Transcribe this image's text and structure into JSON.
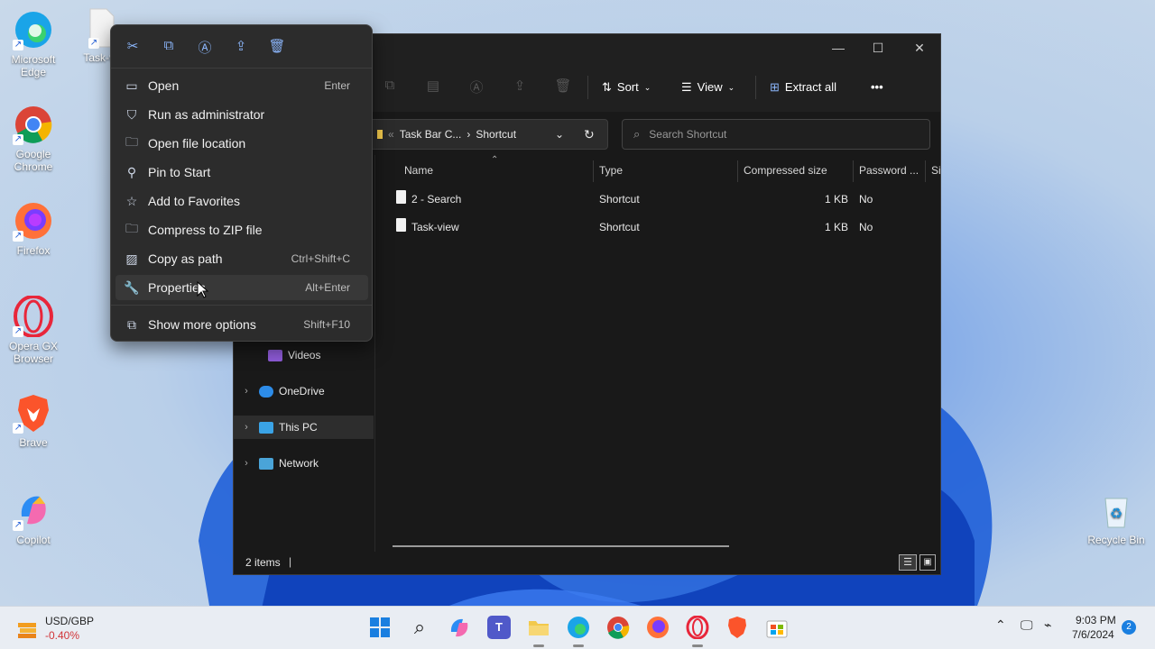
{
  "desktop": {
    "icons": [
      {
        "label": "Microsoft Edge"
      },
      {
        "label": "Google Chrome"
      },
      {
        "label": "Firefox"
      },
      {
        "label": "Opera GX Browser"
      },
      {
        "label": "Brave"
      },
      {
        "label": "Copilot"
      },
      {
        "label": "Task-vi"
      },
      {
        "label": "Recycle Bin"
      }
    ]
  },
  "explorer": {
    "toolbar": {
      "sort": "Sort",
      "view": "View",
      "extract_all": "Extract all",
      "more": "•••"
    },
    "address": {
      "parent": "Task Bar C...",
      "current": "Shortcut"
    },
    "search": {
      "placeholder": "Search Shortcut"
    },
    "columns": {
      "name": "Name",
      "type": "Type",
      "compressed_size": "Compressed size",
      "password": "Password ...",
      "size": "Si"
    },
    "files": [
      {
        "name": "2 - Search",
        "type": "Shortcut",
        "size": "1 KB",
        "password": "No"
      },
      {
        "name": "Task-view",
        "type": "Shortcut",
        "size": "1 KB",
        "password": "No"
      }
    ],
    "nav": {
      "videos": "Videos",
      "onedrive": "OneDrive",
      "this_pc": "This PC",
      "network": "Network"
    },
    "status": {
      "items": "2 items"
    }
  },
  "context_menu": {
    "quick_actions": [
      "cut-icon",
      "copy-icon",
      "rename-icon",
      "share-icon",
      "delete-icon"
    ],
    "items": [
      {
        "label": "Open",
        "shortcut": "Enter"
      },
      {
        "label": "Run as administrator",
        "shortcut": ""
      },
      {
        "label": "Open file location",
        "shortcut": ""
      },
      {
        "label": "Pin to Start",
        "shortcut": ""
      },
      {
        "label": "Add to Favorites",
        "shortcut": ""
      },
      {
        "label": "Compress to ZIP file",
        "shortcut": ""
      },
      {
        "label": "Copy as path",
        "shortcut": "Ctrl+Shift+C"
      },
      {
        "label": "Properties",
        "shortcut": "Alt+Enter"
      },
      {
        "label": "Show more options",
        "shortcut": "Shift+F10"
      }
    ]
  },
  "taskbar": {
    "widget": {
      "title": "USD/GBP",
      "value": "-0.40%"
    },
    "time": "9:03 PM",
    "date": "7/6/2024",
    "notifications": "2"
  },
  "colors": {
    "accent": "#0078d4",
    "negative": "#d13438"
  }
}
